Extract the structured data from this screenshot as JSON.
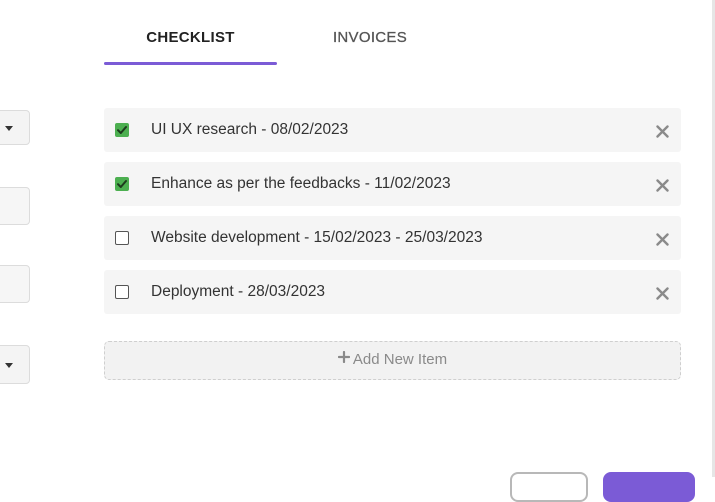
{
  "colors": {
    "accent": "#7b5bd6",
    "checkbox_checked": "#4caf50",
    "remove_icon": "#8a8a8a"
  },
  "tabs": [
    {
      "label": "CHECKLIST",
      "active": true
    },
    {
      "label": "INVOICES",
      "active": false
    }
  ],
  "checklist": {
    "items": [
      {
        "text": "UI UX research - 08/02/2023",
        "checked": true,
        "remove_icon": "close-icon"
      },
      {
        "text": "Enhance as per the feedbacks - 11/02/2023",
        "checked": true,
        "remove_icon": "close-icon"
      },
      {
        "text": "Website development - 15/02/2023 - 25/03/2023",
        "checked": false,
        "remove_icon": "close-icon"
      },
      {
        "text": "Deployment - 28/03/2023",
        "checked": false,
        "remove_icon": "close-icon"
      }
    ],
    "add_label": "Add New Item",
    "add_icon": "plus-icon"
  }
}
